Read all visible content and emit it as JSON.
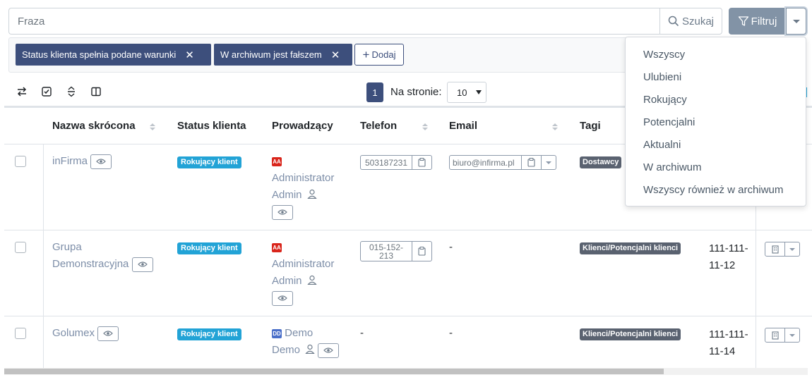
{
  "search": {
    "placeholder": "Fraza",
    "search_label": "Szukaj",
    "filter_label": "Filtruj"
  },
  "filters": {
    "chips": [
      {
        "label": "Status klienta spełnia podane warunki"
      },
      {
        "label": "W archiwum jest fałszem"
      }
    ],
    "add_label": "Dodaj"
  },
  "pagination": {
    "current_page": "1",
    "per_page_label": "Na stronie:",
    "per_page_value": "10"
  },
  "table": {
    "columns": {
      "name": "Nazwa skrócona",
      "status": "Status klienta",
      "manager": "Prowadzący",
      "phone": "Telefon",
      "email": "Email",
      "tags": "Tagi"
    },
    "rows": [
      {
        "name": "inFirma",
        "status": "Rokujący klient",
        "manager_initials": "AA",
        "manager_line1": "Administrator",
        "manager_line2": "Admin",
        "phone": "503187231",
        "email": "biuro@infirma.pl",
        "tag": "Dostawcy",
        "nip_line1": "",
        "nip_line2": ""
      },
      {
        "name_line1": "Grupa",
        "name_line2": "Demonstracyjna",
        "status": "Rokujący klient",
        "manager_initials": "AA",
        "manager_line1": "Administrator",
        "manager_line2": "Admin",
        "phone_line1": "015-152-",
        "phone_line2": "213",
        "email": "-",
        "tag": "Klienci/Potencjalni klienci",
        "nip_line1": "111-111-",
        "nip_line2": "11-12"
      },
      {
        "name": "Golumex",
        "status": "Rokujący klient",
        "manager_initials": "DD",
        "manager_line1": "Demo",
        "manager_line2": "Demo",
        "phone": "-",
        "email": "-",
        "tag": "Klienci/Potencjalni klienci",
        "nip_line1": "111-111-",
        "nip_line2": "11-14"
      }
    ]
  },
  "filter_menu": {
    "items": [
      {
        "label": "Wszyscy"
      },
      {
        "label": "Ulubieni"
      },
      {
        "label": "Rokujący"
      },
      {
        "label": "Potencjalni"
      },
      {
        "label": "Aktualni"
      },
      {
        "label": "W archiwum"
      },
      {
        "label": "Wszyscy również w archiwum"
      }
    ]
  },
  "colors": {
    "primary": "#3d4f7c",
    "filter_button": "#8293a6",
    "status_badge": "#22a3d6",
    "tag_badge": "#5a6270",
    "avatar_admin": "#d9261c",
    "avatar_demo": "#4a6fc9",
    "link": "#7d8ea8"
  },
  "icons": {
    "search": "search-icon",
    "filter": "filter-icon",
    "close": "close-icon",
    "plus": "plus-icon",
    "eye": "eye-icon",
    "user": "user-icon",
    "clipboard": "clipboard-icon",
    "building": "building-icon"
  }
}
